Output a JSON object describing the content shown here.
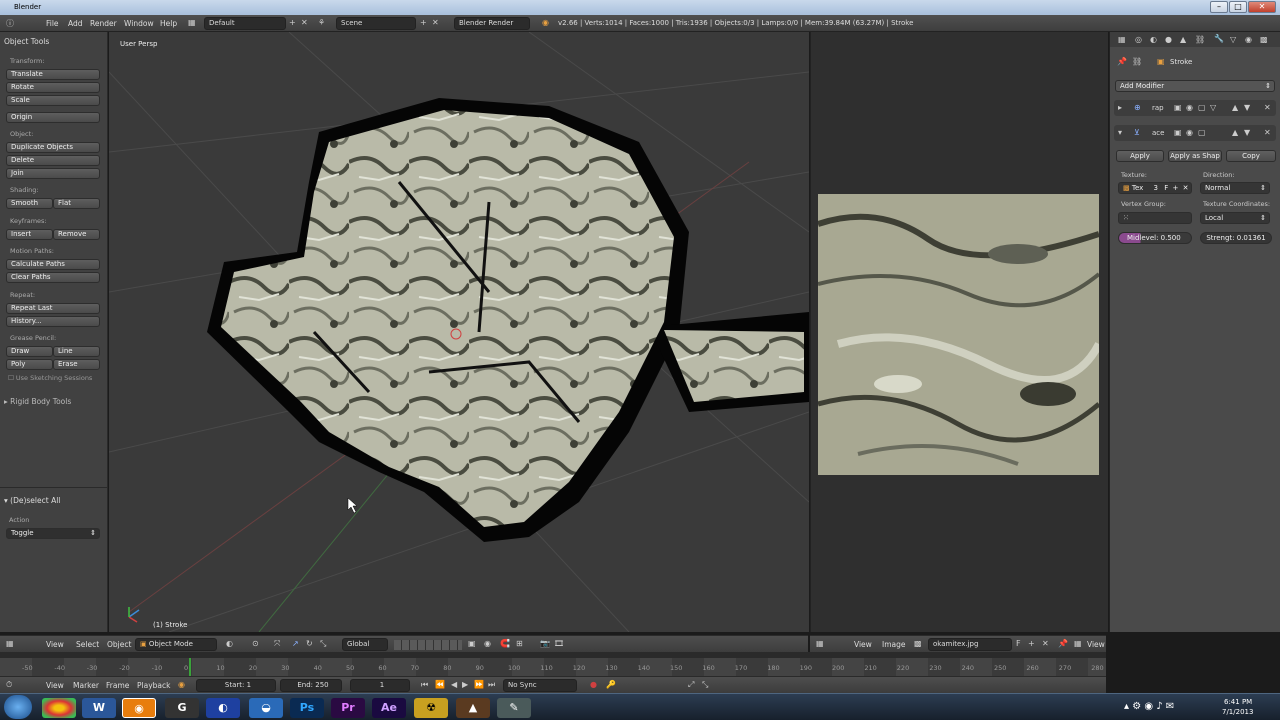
{
  "window": {
    "title": "Blender"
  },
  "menu": {
    "file": "File",
    "add": "Add",
    "render": "Render",
    "window": "Window",
    "help": "Help"
  },
  "screen": "Default",
  "scene": "Scene",
  "engine": "Blender Render",
  "stats": "v2.66 | Verts:1014 | Faces:1000 | Tris:1936 | Objects:0/3 | Lamps:0/0 | Mem:39.84M (63.27M) | Stroke",
  "tools": {
    "header": "Object Tools",
    "transform_label": "Transform:",
    "translate": "Translate",
    "rotate": "Rotate",
    "scale": "Scale",
    "origin": "Origin",
    "object_label": "Object:",
    "duplicate": "Duplicate Objects",
    "delete": "Delete",
    "join": "Join",
    "shading_label": "Shading:",
    "smooth": "Smooth",
    "flat": "Flat",
    "keyframes_label": "Keyframes:",
    "insert": "Insert",
    "remove": "Remove",
    "motion_label": "Motion Paths:",
    "calc_paths": "Calculate Paths",
    "clear_paths": "Clear Paths",
    "repeat_label": "Repeat:",
    "repeat_last": "Repeat Last",
    "history": "History...",
    "grease_label": "Grease Pencil:",
    "draw": "Draw",
    "line": "Line",
    "poly": "Poly",
    "erase": "Erase",
    "sketching": "Use Sketching Sessions",
    "rigid": "Rigid Body Tools",
    "deselect": "(De)select All",
    "action_label": "Action",
    "toggle": "Toggle"
  },
  "viewport": {
    "persp": "User Persp",
    "object": "(1) Stroke"
  },
  "props": {
    "object_name": "Stroke",
    "add_modifier": "Add Modifier",
    "mod1": "rap",
    "mod2": "ace",
    "apply": "Apply",
    "apply_shape": "Apply as Shap",
    "copy": "Copy",
    "texture_label": "Texture:",
    "texture_value": "Tex",
    "texture_users": "3",
    "direction_label": "Direction:",
    "direction_value": "Normal",
    "vgroup_label": "Vertex Group:",
    "texcoords_label": "Texture Coordinates:",
    "texcoords_value": "Local",
    "midlevel": "Midlevel: 0.500",
    "strength": "Strengt: 0.01361"
  },
  "view3d_header": {
    "view": "View",
    "select": "Select",
    "object": "Object",
    "mode": "Object Mode",
    "orientation": "Global"
  },
  "image_header": {
    "view": "View",
    "image": "Image",
    "filename": "okamitex.jpg",
    "view2": "View"
  },
  "timeline": {
    "ticks": [
      "-50",
      "-40",
      "-30",
      "-20",
      "-10",
      "0",
      "10",
      "20",
      "30",
      "40",
      "50",
      "60",
      "70",
      "80",
      "90",
      "100",
      "110",
      "120",
      "130",
      "140",
      "150",
      "160",
      "170",
      "180",
      "190",
      "200",
      "210",
      "220",
      "230",
      "240",
      "250",
      "260",
      "270",
      "280"
    ],
    "view": "View",
    "marker": "Marker",
    "frame": "Frame",
    "playback": "Playback",
    "start": "Start: 1",
    "end": "End: 250",
    "current": "1",
    "sync": "No Sync"
  },
  "taskbar": {
    "time": "6:41 PM",
    "date": "7/1/2013"
  }
}
